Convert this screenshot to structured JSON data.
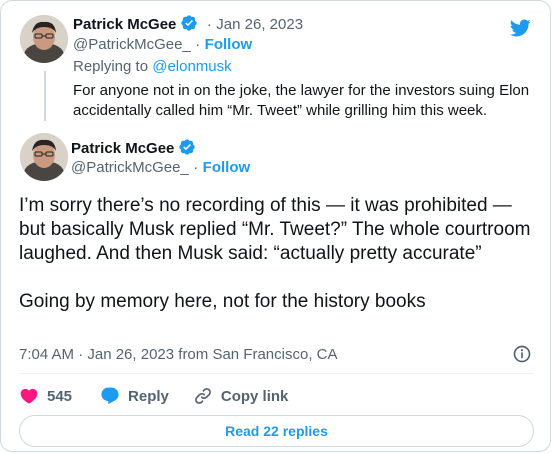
{
  "colors": {
    "accent": "#1d9bf0",
    "like": "#f91880",
    "text": "#0f1419",
    "muted": "#536471",
    "border": "#cfd9de"
  },
  "quoted_tweet": {
    "author_name": "Patrick McGee",
    "separator": "·",
    "date": "Jan 26, 2023",
    "handle": "@PatrickMcGee_",
    "follow_label": "Follow",
    "replying_prefix": "Replying to",
    "replying_to": "@elonmusk",
    "text": "For anyone not in on the joke, the lawyer for the investors suing Elon accidentally called him “Mr. Tweet” while grilling him this week."
  },
  "main_tweet": {
    "author_name": "Patrick McGee",
    "handle": "@PatrickMcGee_",
    "follow_label": "Follow",
    "text": "I’m sorry there’s no recording of this — it was prohibited — but basically Musk replied “Mr. Tweet?” The whole courtroom laughed. And then Musk said: “actually pretty accurate”\n\nGoing by memory here, not for the history books",
    "timestamp": "7:04 AM · Jan 26, 2023 from San Francisco, CA"
  },
  "actions": {
    "like_count": "545",
    "reply_label": "Reply",
    "copy_link_label": "Copy link"
  },
  "read_replies_label": "Read 22 replies",
  "icons": [
    "twitter-bird-icon",
    "verified-badge-icon",
    "info-icon",
    "heart-icon",
    "reply-bubble-icon",
    "link-icon"
  ]
}
